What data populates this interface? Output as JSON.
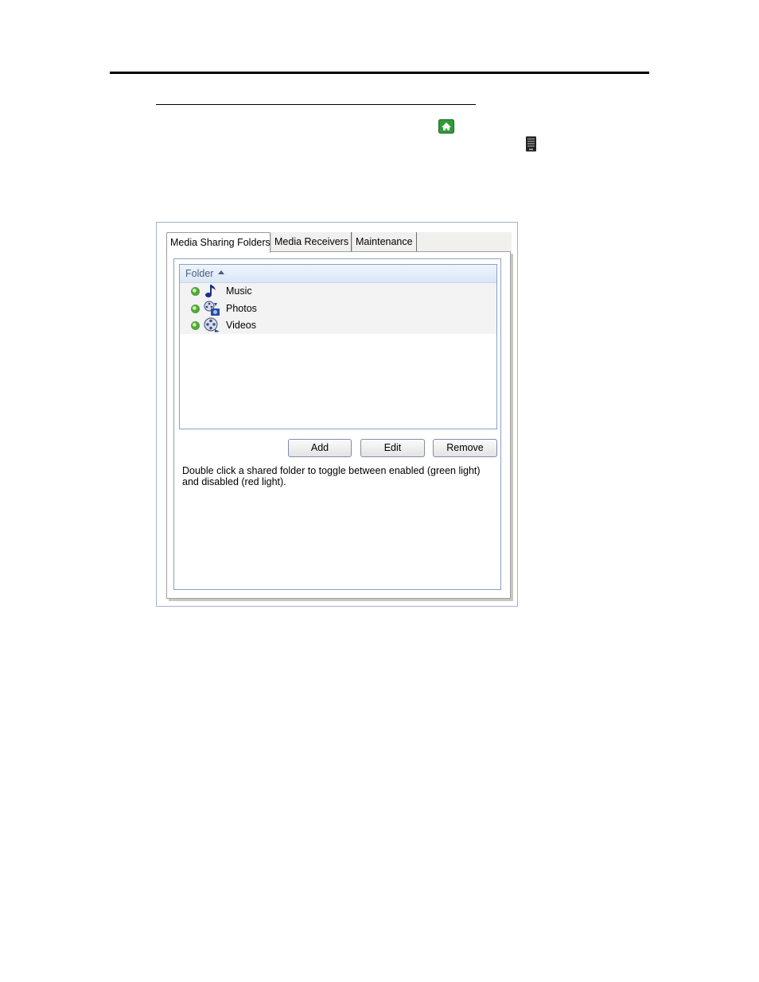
{
  "dialog": {
    "tabs": [
      {
        "label": "Media Sharing Folders",
        "active": true
      },
      {
        "label": "Media Receivers",
        "active": false
      },
      {
        "label": "Maintenance",
        "active": false
      }
    ],
    "list": {
      "column_header": "Folder",
      "sort": "ascending",
      "rows": [
        {
          "label": "Music",
          "status": "enabled",
          "status_color": "#4fa83a",
          "icon": "music-note-icon"
        },
        {
          "label": "Photos",
          "status": "enabled",
          "status_color": "#4fa83a",
          "icon": "photos-folder-icon"
        },
        {
          "label": "Videos",
          "status": "enabled",
          "status_color": "#4fa83a",
          "icon": "videos-folder-icon"
        }
      ]
    },
    "buttons": {
      "add": "Add",
      "edit": "Edit",
      "remove": "Remove"
    },
    "hint": "Double click a shared folder to toggle between enabled (green light) and disabled (red light)."
  },
  "colors": {
    "accent_border": "#8aa0c4",
    "header_text": "#4b5f82",
    "enabled_light": "#4fa83a"
  }
}
